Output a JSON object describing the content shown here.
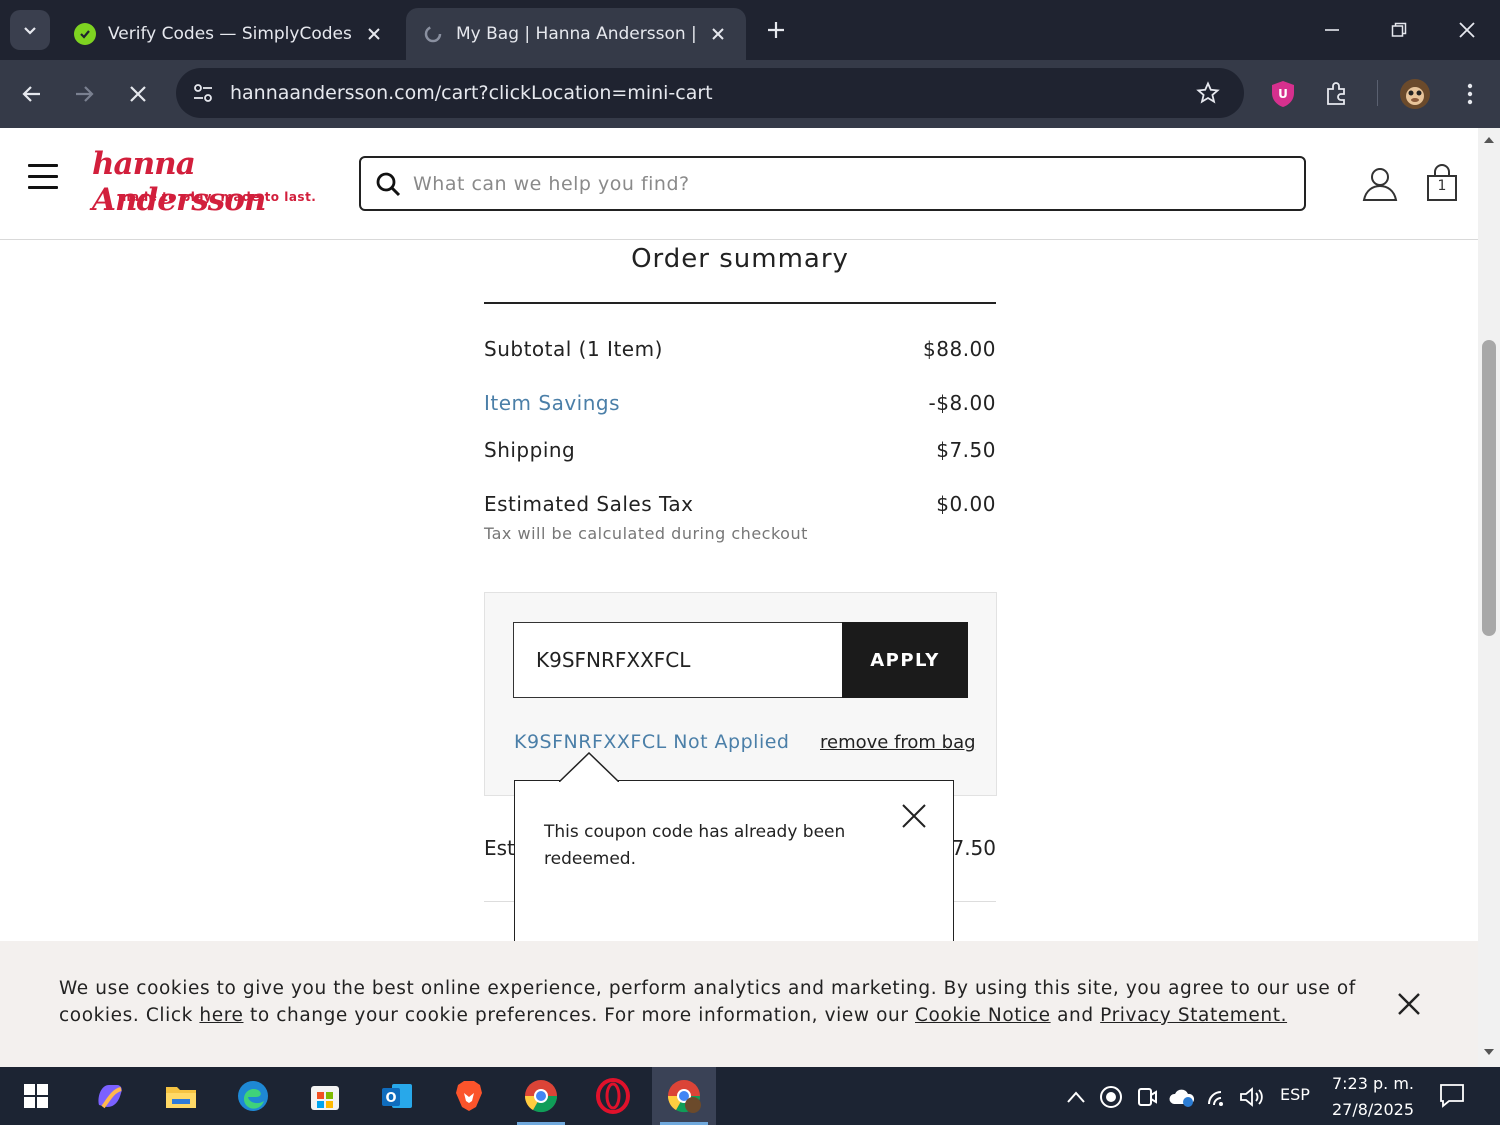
{
  "browser": {
    "tabs": [
      {
        "title": "Verify Codes — SimplyCodes",
        "active": false
      },
      {
        "title": "My Bag | Hanna Andersson | Ha",
        "active": true
      }
    ],
    "url": "hannaandersson.com/cart?clickLocation=mini-cart"
  },
  "site": {
    "logo_text": "hanna Andersson",
    "logo_tagline": "made to play. made to last.",
    "search_placeholder": "What can we help you find?",
    "bag_count": "1"
  },
  "summary": {
    "title": "Order summary",
    "rows": [
      {
        "label": "Subtotal (1 Item)",
        "value": "$88.00"
      },
      {
        "label": "Item Savings",
        "value": "-$8.00"
      },
      {
        "label": "Shipping",
        "value": "$7.50"
      },
      {
        "label": "Estimated Sales Tax",
        "value": "$0.00"
      }
    ],
    "tax_note": "Tax will be calculated during checkout",
    "estimated_total_label": "Esti",
    "estimated_total_value": "7.50"
  },
  "coupon": {
    "code_value": "K9SFNRFXXFCL",
    "apply_label": "APPLY",
    "status_text": "K9SFNRFXXFCL Not Applied",
    "remove_label": "remove from bag"
  },
  "popover": {
    "message": "This coupon code has already been redeemed."
  },
  "cookie": {
    "text_before": "We use cookies to give you the best online experience, perform analytics and marketing. By using this site, you agree to our use of cookies. Click ",
    "here_link": "here",
    "text_middle": " to change your cookie preferences. For more information, view our ",
    "notice_link": "Cookie Notice",
    "and_text": " and ",
    "privacy_link": "Privacy Statement."
  },
  "taskbar": {
    "language": "ESP",
    "time": "7:23 p. m.",
    "date": "27/8/2025"
  },
  "colors": {
    "brand_red": "#d21f3c",
    "link_blue": "#4b7fa8",
    "button_black": "#1b1b1b"
  }
}
